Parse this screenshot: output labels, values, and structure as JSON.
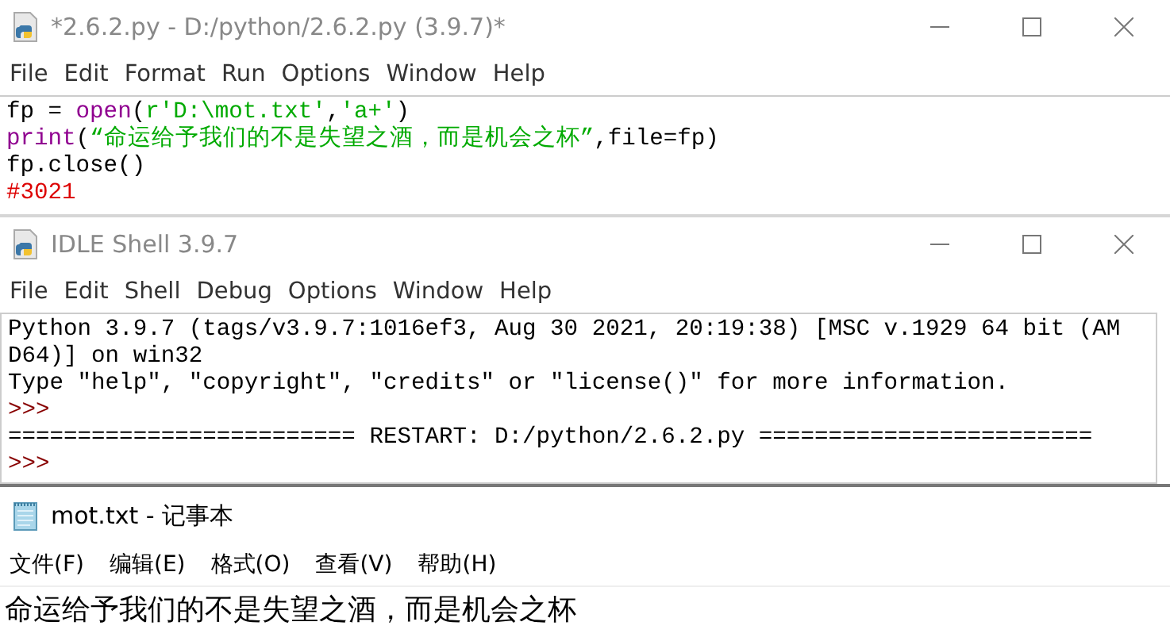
{
  "editor": {
    "title": "*2.6.2.py - D:/python/2.6.2.py (3.9.7)*",
    "menu": [
      "File",
      "Edit",
      "Format",
      "Run",
      "Options",
      "Window",
      "Help"
    ],
    "lines": [
      [
        {
          "text": "fp = ",
          "kind": "plain"
        },
        {
          "text": "open",
          "kind": "builtin"
        },
        {
          "text": "(",
          "kind": "plain"
        },
        {
          "text": "r'D:\\mot.txt'",
          "kind": "string"
        },
        {
          "text": ",",
          "kind": "plain"
        },
        {
          "text": "'a+'",
          "kind": "string"
        },
        {
          "text": ")",
          "kind": "plain"
        }
      ],
      [
        {
          "text": "print",
          "kind": "builtin"
        },
        {
          "text": "(",
          "kind": "plain"
        },
        {
          "text": "“命运给予我们的不是失望之酒，而是机会之杯”",
          "kind": "string"
        },
        {
          "text": ",file=fp)",
          "kind": "plain"
        }
      ],
      [
        {
          "text": "fp.close()",
          "kind": "plain"
        }
      ],
      [
        {
          "text": "#3021",
          "kind": "comment"
        }
      ]
    ]
  },
  "shell": {
    "title": "IDLE Shell 3.9.7",
    "menu": [
      "File",
      "Edit",
      "Shell",
      "Debug",
      "Options",
      "Window",
      "Help"
    ],
    "lines": [
      [
        {
          "text": "Python 3.9.7 (tags/v3.9.7:1016ef3, Aug 30 2021, 20:19:38) [MSC v.1929 64 bit (AM",
          "kind": "plain"
        }
      ],
      [
        {
          "text": "D64)] on win32",
          "kind": "plain"
        }
      ],
      [
        {
          "text": "Type \"help\", \"copyright\", \"credits\" or \"license()\" for more information.",
          "kind": "plain"
        }
      ],
      [
        {
          "text": ">>>",
          "kind": "prompt"
        }
      ],
      [
        {
          "text": "========================= RESTART: D:/python/2.6.2.py ========================",
          "kind": "plain"
        }
      ],
      [
        {
          "text": ">>>",
          "kind": "prompt"
        }
      ]
    ]
  },
  "notepad": {
    "title": "mot.txt - 记事本",
    "menu": [
      "文件(F)",
      "编辑(E)",
      "格式(O)",
      "查看(V)",
      "帮助(H)"
    ],
    "text": "命运给予我们的不是失望之酒，而是机会之杯"
  }
}
